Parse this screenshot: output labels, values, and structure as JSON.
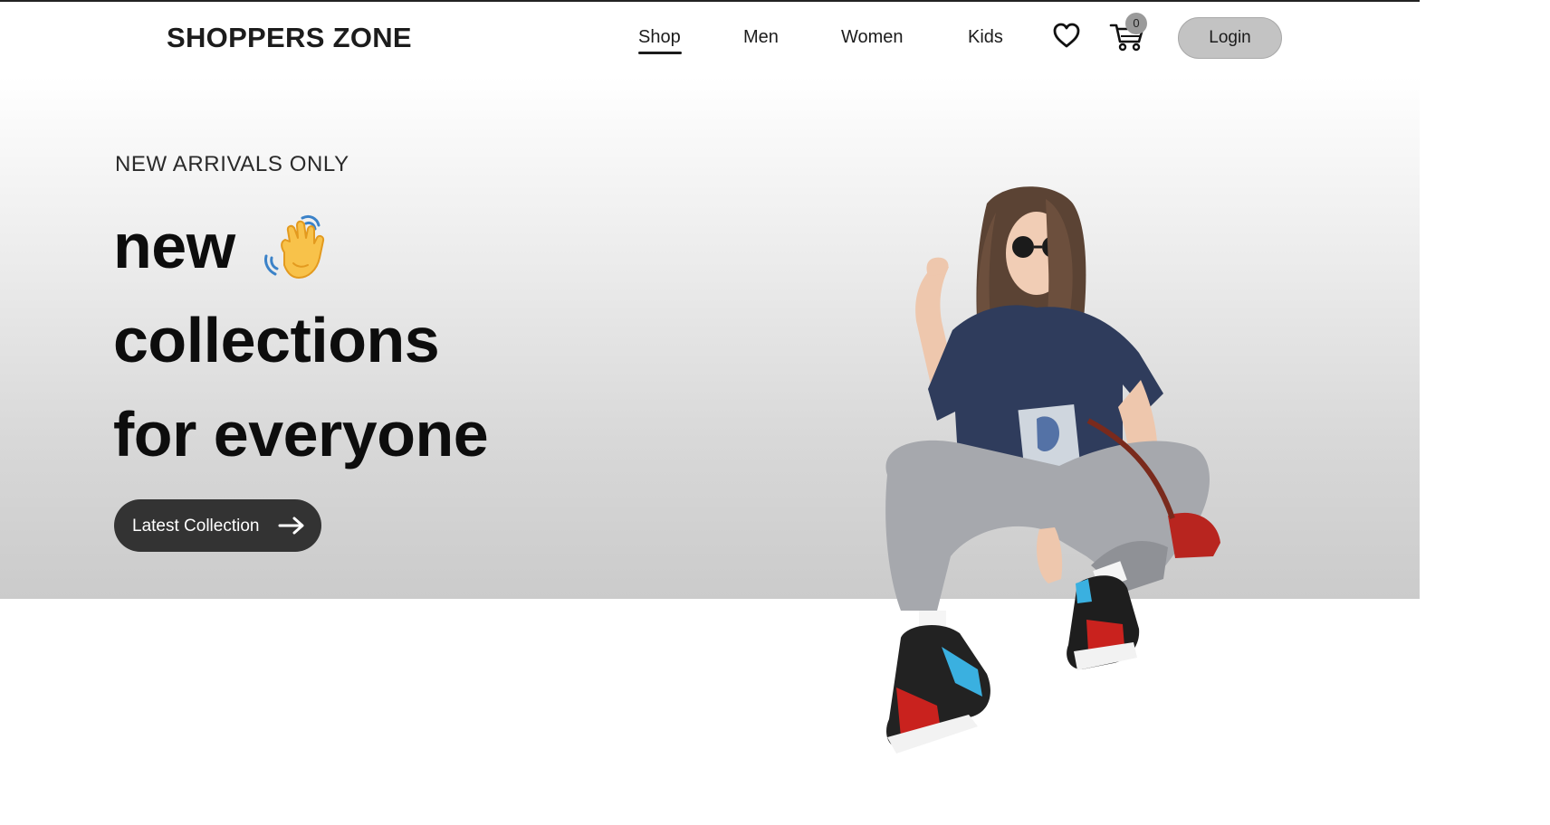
{
  "header": {
    "logo": "SHOPPERS ZONE",
    "nav": [
      {
        "label": "Shop",
        "active": true
      },
      {
        "label": "Men",
        "active": false
      },
      {
        "label": "Women",
        "active": false
      },
      {
        "label": "Kids",
        "active": false
      }
    ],
    "wishlist_icon": "heart-icon",
    "cart_icon": "cart-icon",
    "cart_count": "0",
    "login_label": "Login"
  },
  "hero": {
    "eyebrow": "NEW ARRIVALS ONLY",
    "headline_lines": [
      "new",
      "collections",
      "for everyone"
    ],
    "headline_icon": "waving-hand-icon",
    "cta_label": "Latest Collection",
    "cta_icon": "arrow-right-icon",
    "image": "hero-model-image"
  },
  "colors": {
    "text_dark": "#1c1c1c",
    "login_bg": "#c3c3c3",
    "cta_bg": "#333333",
    "hero_gradient_end": "#cbcbcb",
    "cart_badge": "#9a9a9a"
  }
}
